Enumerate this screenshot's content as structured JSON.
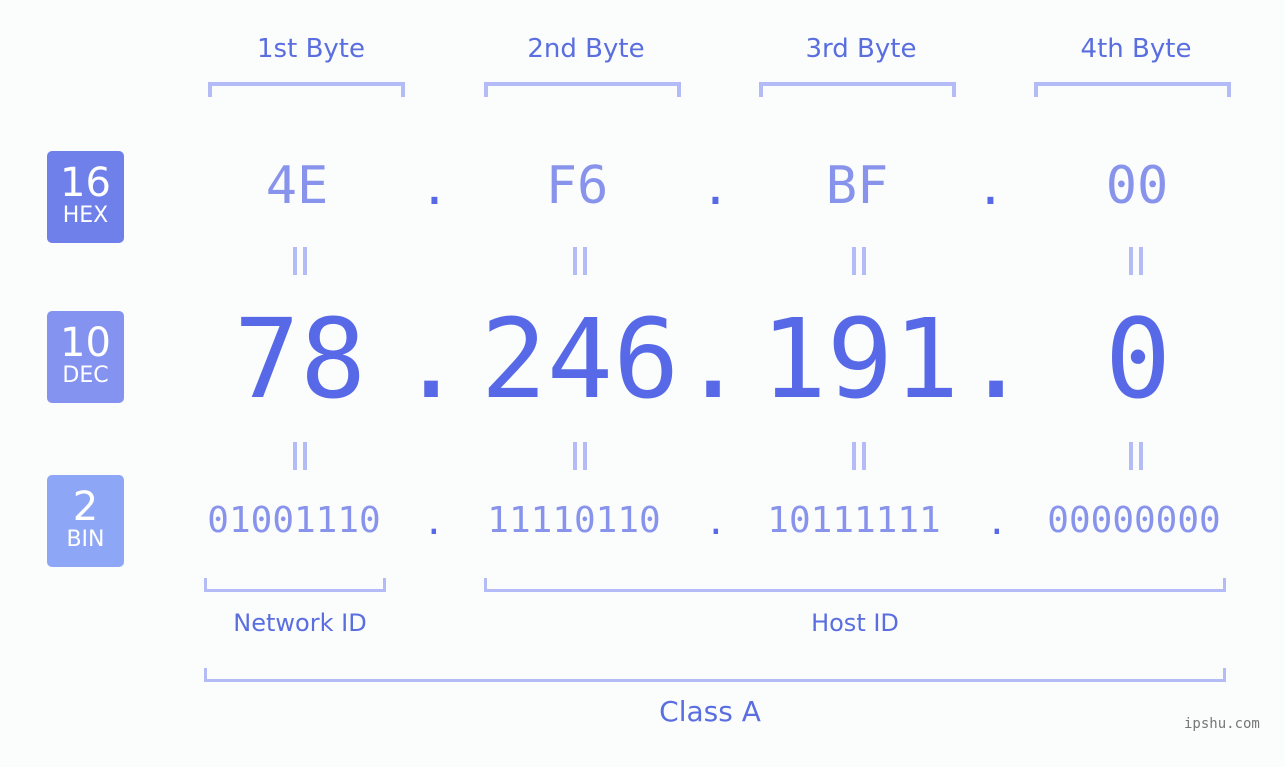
{
  "bases": [
    {
      "num": "16",
      "label": "HEX",
      "color": "#6f80ea"
    },
    {
      "num": "10",
      "label": "DEC",
      "color": "#8593f0"
    },
    {
      "num": "2",
      "label": "BIN",
      "color": "#8ea6f6"
    }
  ],
  "byte_headers": [
    "1st Byte",
    "2nd Byte",
    "3rd Byte",
    "4th Byte"
  ],
  "hex": [
    "4E",
    "F6",
    "BF",
    "00"
  ],
  "dec": [
    "78",
    "246",
    "191",
    "0"
  ],
  "bin": [
    "01001110",
    "11110110",
    "10111111",
    "00000000"
  ],
  "separator": ".",
  "network_label": "Network ID",
  "host_label": "Host ID",
  "class_label": "Class A",
  "watermark": "ipshu.com"
}
